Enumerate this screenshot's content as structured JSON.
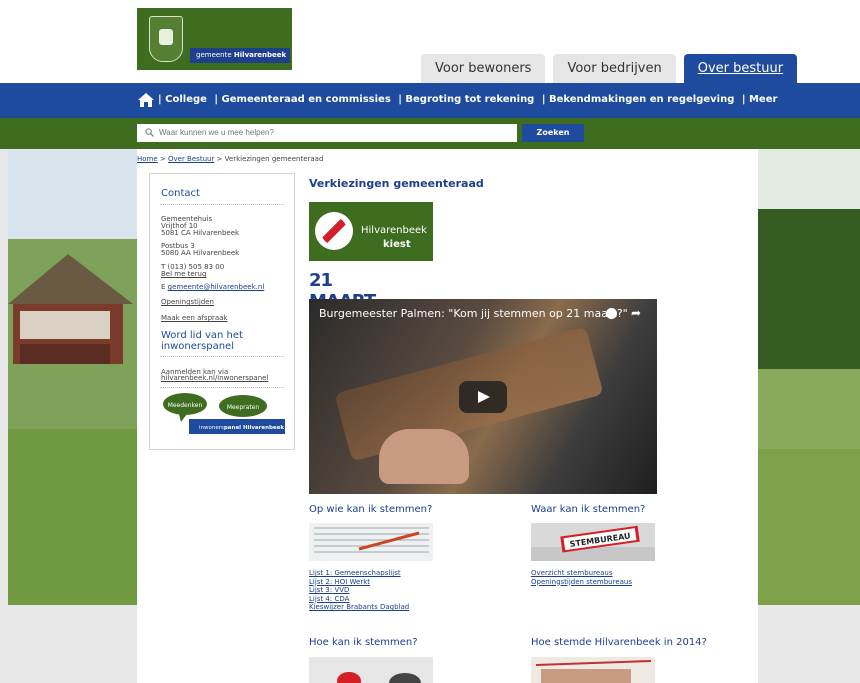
{
  "header": {
    "logo_text_prefix": "gemeente ",
    "logo_text_name": "Hilvarenbeek",
    "tabs": [
      {
        "label": "Voor bewoners"
      },
      {
        "label": "Voor bedrijven"
      },
      {
        "label": "Over bestuur",
        "active": true
      }
    ]
  },
  "nav": {
    "items": [
      "| College",
      "| Gemeenteraad en commissies",
      "| Begroting tot rekening",
      "| Bekendmakingen en regelgeving",
      "| Meer"
    ]
  },
  "search": {
    "placeholder": "Waar kunnen we u mee helpen?",
    "button": "Zoeken"
  },
  "breadcrumb": {
    "home": "Home",
    "sep1": " > ",
    "over": "Over Bestuur",
    "sep2": " > Verkiezingen gemeenteraad"
  },
  "sidebar": {
    "contact_title": "Contact",
    "addr1": "Gemeentehuis",
    "addr2": "Vrijthof 10",
    "addr3": "5081 CA Hilvarenbeek",
    "post1": "Postbus 3",
    "post2": "5080 AA Hilvarenbeek",
    "phone": "T (013) 505 83 00",
    "callback": "Bel me terug",
    "email_prefix": "E ",
    "email": "gemeente@hilvarenbeek.nl",
    "hours": "Openingstijden",
    "appointment": "Maak een afspraak",
    "panel_title_1": "Word lid van het",
    "panel_title_2": "inwonerspanel",
    "signup_1": "Aanmelden kan via",
    "signup_link": "hilvarenbeek.nl/inwonerspanel",
    "bubble1": "Meedenken",
    "bubble2": "Meepraten",
    "panel_banner_light": "inwoners",
    "panel_banner_bold": "panel Hilvarenbeek"
  },
  "main": {
    "title": "Verkiezingen gemeenteraad",
    "kiest_line1": "Hilvarenbeek",
    "kiest_line2": "kiest",
    "date": "21 MAART 2018",
    "video_title": "Burgemeester Palmen: \"Kom jij stemmen op 21 maart?\"",
    "sections": [
      {
        "title": "Op wie kan ik stemmen?",
        "links": [
          "Lijst 1: Gemeenschapslijst",
          "Lijst 2: HOI Werkt",
          "Lijst 3: VVD",
          "Lijst 4: CDA",
          "Kieswijzer Brabants Dagblad"
        ]
      },
      {
        "title": "Waar kan ik stemmen?",
        "sign": "STEMBUREAU",
        "links": [
          "Overzicht stembureaus",
          "Openingstijden stembureaus"
        ]
      },
      {
        "title": "Hoe kan ik stemmen?"
      },
      {
        "title": "Hoe stemde Hilvarenbeek in 2014?"
      }
    ]
  },
  "colors": {
    "brand_blue": "#1e4b9e",
    "brand_green": "#3f6d1f",
    "vote_red": "#d41f26"
  }
}
